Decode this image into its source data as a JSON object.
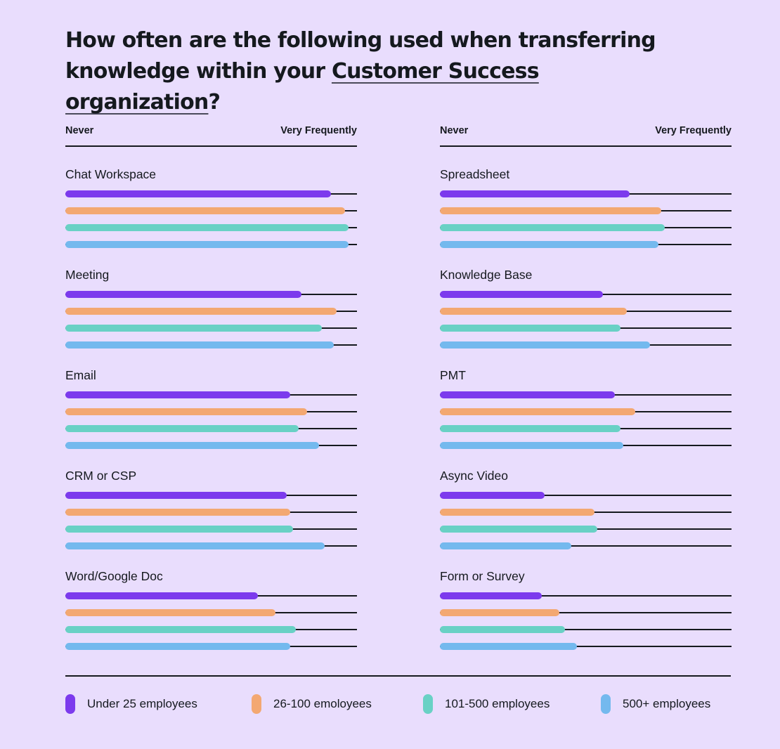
{
  "title": {
    "prefix": "How often are the following used when transferring knowledge within your ",
    "highlight": "Customer Success organization",
    "suffix": "?"
  },
  "colors": {
    "background": "#e9ddfd",
    "text": "#15191e",
    "under25": "#7c3aed",
    "26to100": "#f3a872",
    "101to500": "#69d1c5",
    "500plus": "#74b9ee"
  },
  "chart_data": {
    "type": "bar",
    "orientation": "horizontal",
    "title": "How often are the following used when transferring knowledge within your Customer Success organization?",
    "scale": {
      "min_label": "Never",
      "max_label": "Very Frequently",
      "range": [
        0,
        100
      ],
      "unit": "percent of scale"
    },
    "legend_position": "bottom",
    "series": [
      {
        "name": "Under 25 employees",
        "color": "#7c3aed"
      },
      {
        "name": "26-100 emoloyees",
        "color": "#f3a872"
      },
      {
        "name": "101-500 employees",
        "color": "#69d1c5"
      },
      {
        "name": "500+ employees",
        "color": "#74b9ee"
      }
    ],
    "panels": [
      {
        "header": {
          "left": "Never",
          "right": "Very Frequently"
        },
        "categories": [
          {
            "label": "Chat Workspace",
            "values": [
              91,
              96,
              97,
              97
            ]
          },
          {
            "label": "Meeting",
            "values": [
              81,
              93,
              88,
              92
            ]
          },
          {
            "label": "Email",
            "values": [
              77,
              83,
              80,
              87
            ]
          },
          {
            "label": "CRM or CSP",
            "values": [
              76,
              77,
              78,
              89
            ]
          },
          {
            "label": "Word/Google Doc",
            "values": [
              66,
              72,
              79,
              77
            ]
          }
        ]
      },
      {
        "header": {
          "left": "Never",
          "right": "Very Frequently"
        },
        "categories": [
          {
            "label": "Spreadsheet",
            "values": [
              65,
              76,
              77,
              75
            ]
          },
          {
            "label": "Knowledge Base",
            "values": [
              56,
              64,
              62,
              72
            ]
          },
          {
            "label": "PMT",
            "values": [
              60,
              67,
              62,
              63
            ]
          },
          {
            "label": "Async Video",
            "values": [
              36,
              53,
              54,
              45
            ]
          },
          {
            "label": "Form or Survey",
            "values": [
              35,
              41,
              43,
              47
            ]
          }
        ]
      }
    ]
  }
}
